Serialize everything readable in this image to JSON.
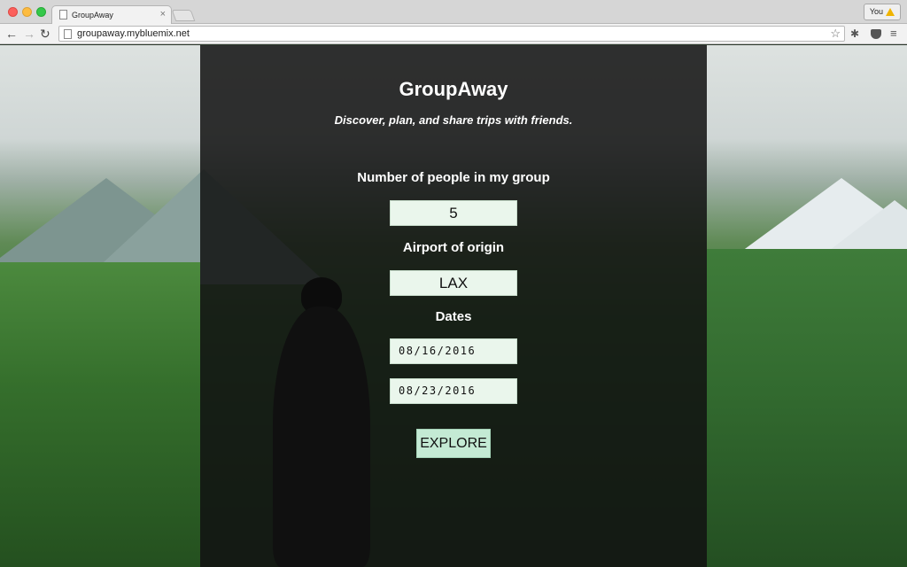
{
  "browser": {
    "tab_title": "GroupAway",
    "tab_close": "×",
    "user_label": "You",
    "url": "groupaway.mybluemix.net",
    "back_glyph": "←",
    "forward_glyph": "→",
    "reload_glyph": "↻",
    "star_glyph": "☆",
    "puzzle_glyph": "✱",
    "menu_glyph": "≡"
  },
  "app": {
    "title": "GroupAway",
    "tagline": "Discover, plan, and share trips with friends."
  },
  "form": {
    "people_label": "Number of people in my group",
    "people_value": "5",
    "origin_label": "Airport of origin",
    "origin_value": "LAX",
    "dates_label": "Dates",
    "start_date": "08/16/2016",
    "end_date": "08/23/2016",
    "explore_label": "EXPLORE"
  },
  "colors": {
    "input_bg": "#eaf6ec",
    "button_bg": "#c4ead4",
    "overlay": "#121212"
  }
}
